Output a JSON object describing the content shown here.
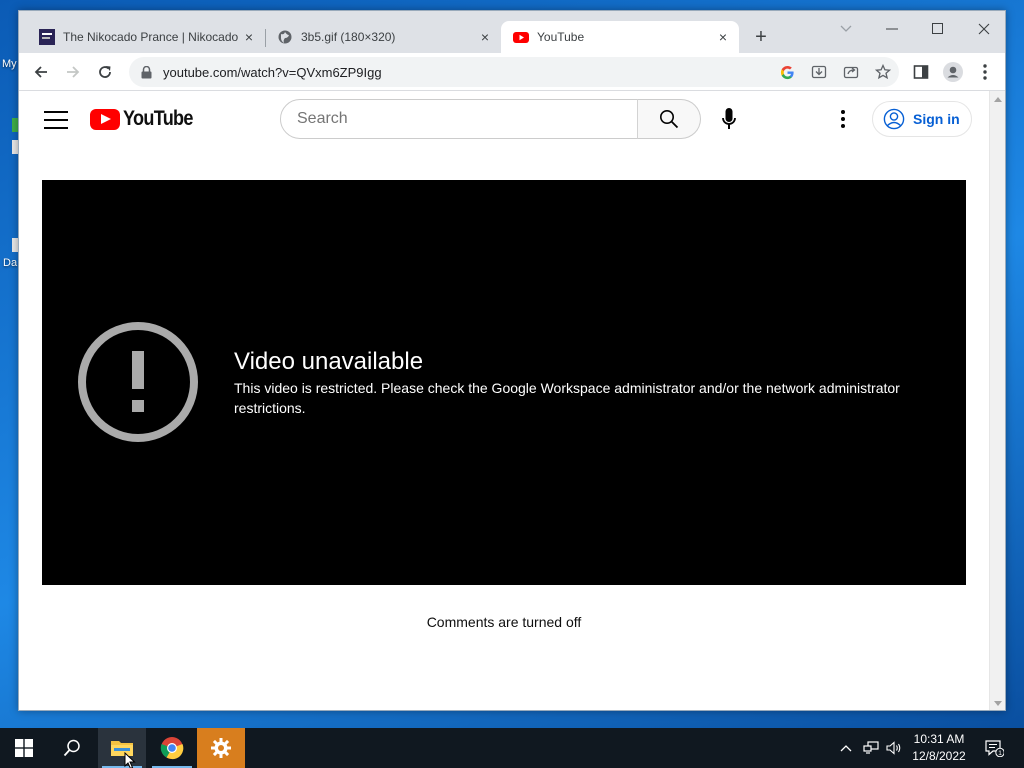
{
  "desktop": {
    "labels": [
      "My",
      "Da"
    ]
  },
  "browser": {
    "tabs": [
      {
        "title": "The Nikocado Prance | Nikocado",
        "favicon": "site-favicon-icon",
        "close": "×"
      },
      {
        "title": "3b5.gif (180×320)",
        "favicon": "globe-icon",
        "close": "×"
      },
      {
        "title": "YouTube",
        "favicon": "youtube-favicon-icon",
        "close": "×"
      }
    ],
    "url": "youtube.com/watch?v=QVxm6ZP9Igg"
  },
  "youtube": {
    "logo_text": "YouTube",
    "search_placeholder": "Search",
    "signin_label": "Sign in",
    "error_title": "Video unavailable",
    "error_message": "This video is restricted. Please check the Google Workspace administrator and/or the network administrator restrictions.",
    "comments_status": "Comments are turned off"
  },
  "taskbar": {
    "time": "10:31 AM",
    "date": "12/8/2022",
    "notification_count": "1"
  },
  "colors": {
    "youtube_red": "#ff0000",
    "link_blue": "#065fd4",
    "taskbar_bg": "#101820",
    "desktop_blue": "#1e88e5"
  }
}
